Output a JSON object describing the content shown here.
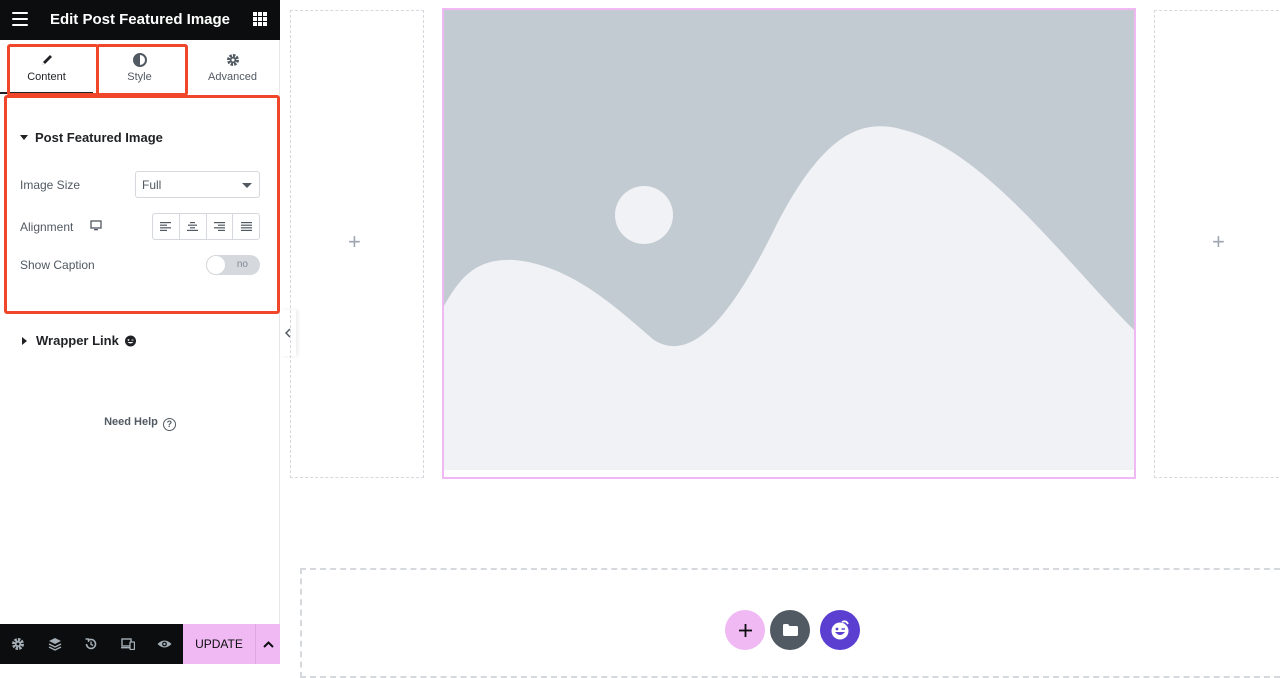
{
  "header": {
    "title": "Edit Post Featured Image",
    "menu_icon": "hamburger-icon",
    "apps_icon": "grid-icon"
  },
  "tabs": [
    {
      "label": "Content",
      "icon": "pencil-icon",
      "active": true
    },
    {
      "label": "Style",
      "icon": "half-circle-icon",
      "active": false
    },
    {
      "label": "Advanced",
      "icon": "gear-icon",
      "active": false
    }
  ],
  "section": {
    "title": "Post Featured Image",
    "image_size_label": "Image Size",
    "image_size_value": "Full",
    "alignment_label": "Alignment",
    "alignment_options": [
      "left",
      "center",
      "right",
      "justify"
    ],
    "show_caption_label": "Show Caption",
    "show_caption_value": "no"
  },
  "wrapper_link": {
    "title": "Wrapper Link"
  },
  "help": {
    "label": "Need Help",
    "icon": "?"
  },
  "footer": {
    "icons": [
      "settings-icon",
      "layers-icon",
      "history-icon",
      "responsive-icon",
      "preview-icon"
    ],
    "update_label": "UPDATE"
  },
  "canvas": {
    "add_glyph": "+",
    "colors": {
      "accent": "#f0b9f3",
      "highlight": "#f0472b",
      "folder_button": "#515962",
      "brand_button": "#5a3fd1",
      "placeholder_sky": "#c3cbd2",
      "placeholder_land": "#f1f2f6"
    }
  }
}
